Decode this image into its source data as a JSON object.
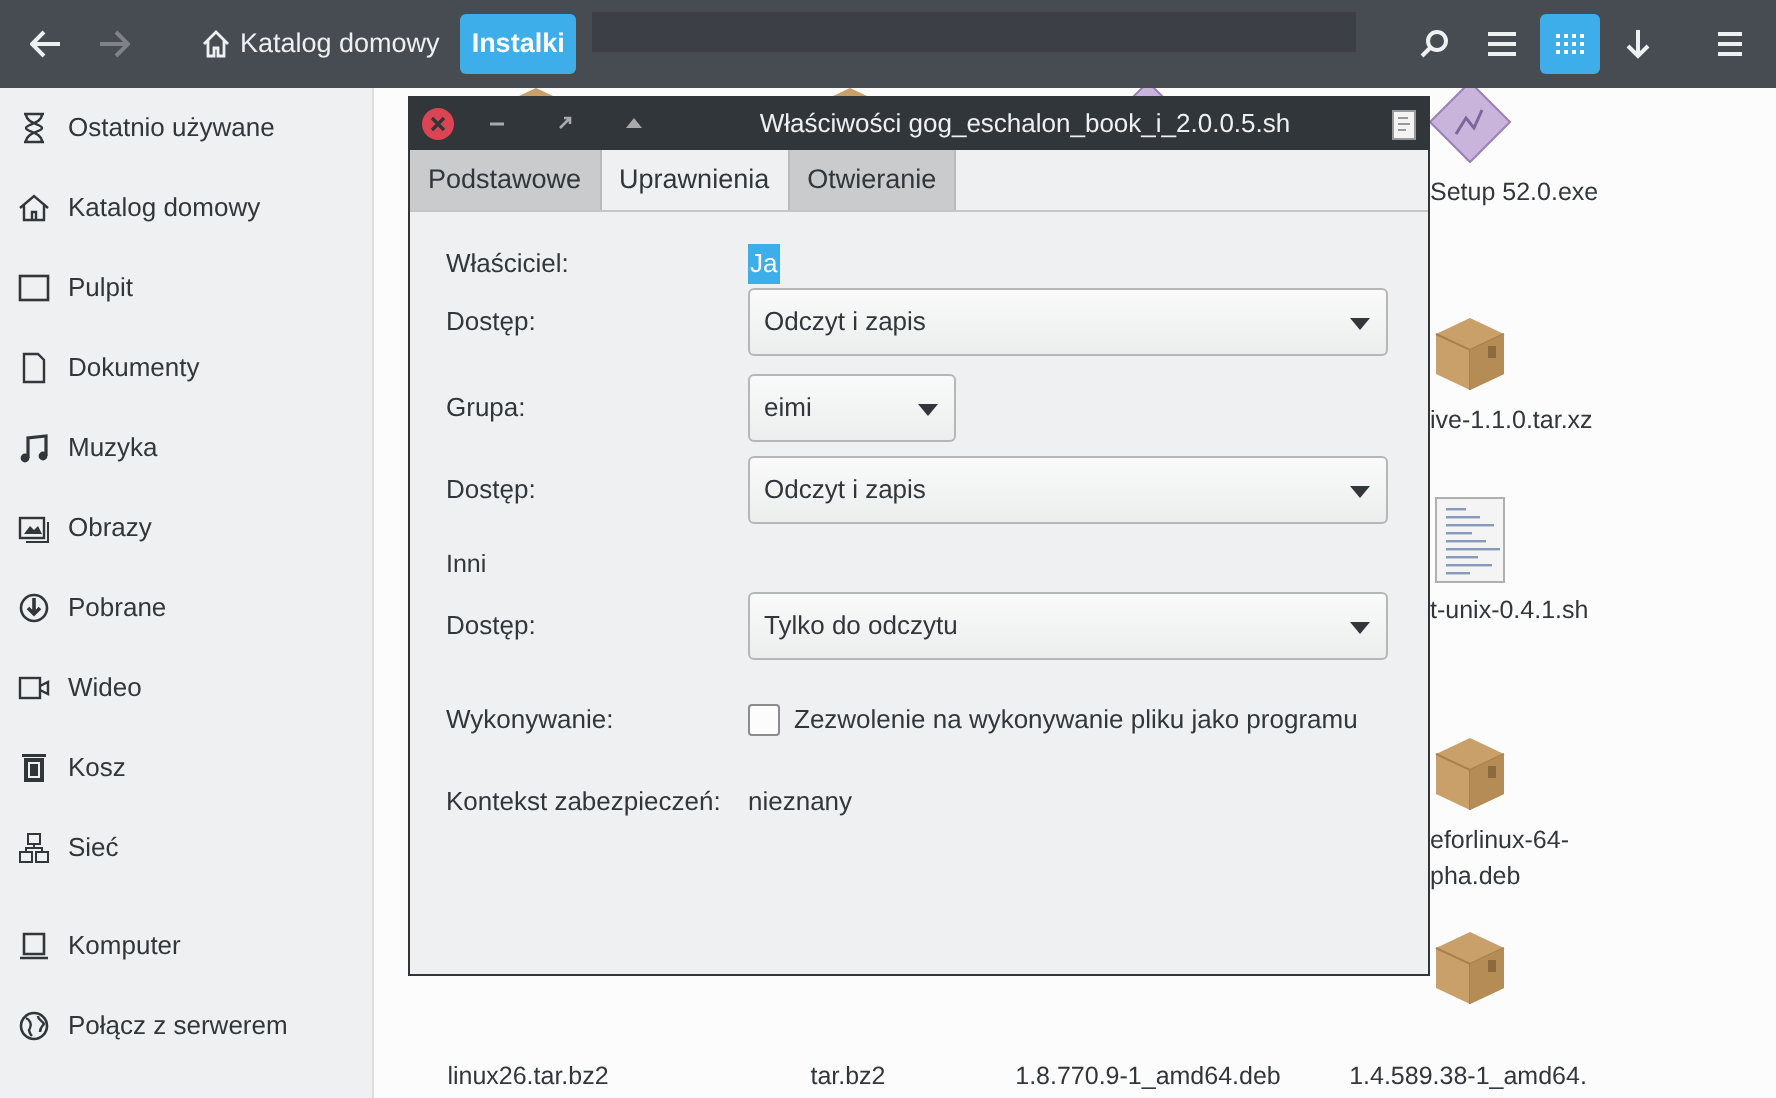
{
  "toolbar": {
    "back": {
      "disabled": false
    },
    "forward": {
      "disabled": true
    },
    "breadcrumbs": [
      {
        "label": "Katalog domowy",
        "selected": false,
        "kind": "home"
      },
      {
        "label": "Instalki",
        "selected": true,
        "kind": "folder"
      }
    ],
    "view_modes": [
      {
        "kind": "list",
        "selected": false
      },
      {
        "kind": "grid",
        "selected": true
      }
    ]
  },
  "sidebar": {
    "groups": [
      [
        {
          "label": "Ostatnio używane"
        },
        {
          "label": "Katalog domowy"
        },
        {
          "label": "Pulpit"
        },
        {
          "label": "Dokumenty"
        },
        {
          "label": "Muzyka"
        },
        {
          "label": "Obrazy"
        },
        {
          "label": "Pobrane"
        },
        {
          "label": "Wideo"
        },
        {
          "label": "Kosz"
        },
        {
          "label": "Sieć"
        }
      ],
      [
        {
          "label": "Komputer"
        },
        {
          "label": "Połącz z serwerem"
        }
      ]
    ]
  },
  "files": [
    {
      "kind": "package"
    },
    {
      "kind": "package"
    },
    {
      "kind": "installer"
    },
    {
      "kind": "installer",
      "lines": [
        "Setup 52.0.exe"
      ]
    },
    {
      "kind": "package",
      "lines": [
        "ive-1.1.0.tar.xz"
      ]
    },
    {
      "kind": "script",
      "lines": [
        "t-unix-0.4.1.sh"
      ]
    },
    {
      "kind": "package",
      "lines": [
        "eforlinux-64-",
        "pha.deb"
      ]
    },
    {
      "kind": "none",
      "lines": [
        "linux26.tar.bz2"
      ]
    },
    {
      "kind": "none",
      "lines": [
        "tar.bz2"
      ]
    },
    {
      "kind": "none",
      "lines": [
        "1.8.770.9-1_amd64.deb"
      ]
    },
    {
      "kind": "package",
      "lines": [
        "1.4.589.38-1_amd64."
      ]
    }
  ],
  "dialog": {
    "title": "Właściwości gog_eschalon_book_i_2.0.0.5.sh",
    "tabs": [
      {
        "label": "Podstawowe",
        "selected": false
      },
      {
        "label": "Uprawnienia",
        "selected": true
      },
      {
        "label": "Otwieranie",
        "selected": false
      }
    ],
    "rows": [
      {
        "kind": "text",
        "label": "Właściciel:",
        "value": "Ja",
        "highlighted": true
      },
      {
        "kind": "select",
        "label": "Dostęp:",
        "value": "Odczyt i zapis",
        "wide": true
      },
      {
        "kind": "select",
        "label": "Grupa:",
        "value": "eimi",
        "wide": false
      },
      {
        "kind": "select",
        "label": "Dostęp:",
        "value": "Odczyt i zapis",
        "wide": true
      },
      {
        "kind": "heading",
        "label": "Inni"
      },
      {
        "kind": "select",
        "label": "Dostęp:",
        "value": "Tylko do odczytu",
        "wide": true
      },
      {
        "kind": "check",
        "label": "Wykonywanie:",
        "value": "Zezwolenie na wykonywanie pliku jako programu",
        "checked": false
      },
      {
        "kind": "text",
        "label": "Kontekst zabezpieczeń:",
        "value": "nieznany",
        "highlighted": false
      }
    ]
  }
}
